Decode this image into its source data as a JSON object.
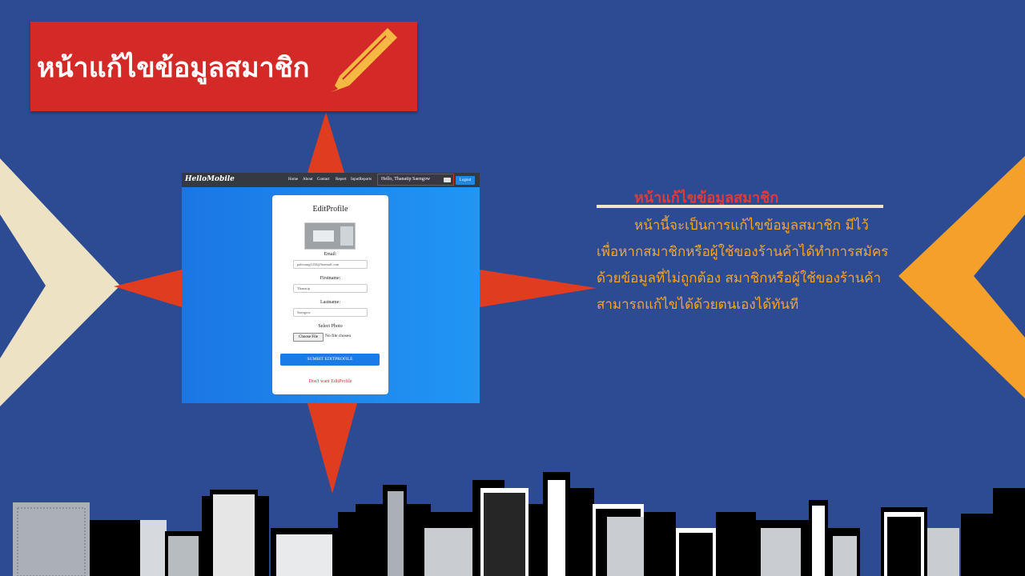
{
  "title": {
    "text": "หน้าแก้ไขข้อมูลสมาชิก"
  },
  "screenshot": {
    "brand": "HelloMobile",
    "nav": [
      "Home",
      "About",
      "Contact",
      "Report",
      "InputReports"
    ],
    "hello": "Hello, Thanatip  Saengow",
    "logout": "Logout",
    "form": {
      "title": "EditProfile",
      "email_label": "Email:",
      "email_value": "paleoung1234@hotmail.com",
      "firstname_label": "Firstname:",
      "firstname_value": "Thanatip",
      "lastname_label": "Lastname:",
      "lastname_value": "Saengow",
      "photo_label": "Select Photo",
      "choose_file": "Choose File",
      "file_status": "No file chosen",
      "submit": "SUMBIT EDITPROFILE",
      "cancel_link": "Don't want EditProfile"
    }
  },
  "description": {
    "heading": "หน้าแก้ไขข้อมูลสมาชิก",
    "lines": [
      "หน้านี้จะเป็นการแก้ไขข้อมูลสมาชิก มีไว้",
      "เพื่อหากสมาชิกหรือผู้ใช้ของร้านค้าได้ทำการสมัคร",
      "ด้วยข้อมูลที่ไม่ถูกต้อง สมาชิกหรือผู้ใช้ของร้านค้า",
      "สามารถแก้ไขได้ด้วยตนเองได้ทันที"
    ]
  },
  "colors": {
    "background": "#2d4b93",
    "banner": "#d42a27",
    "arrow": "#e03c1f",
    "chevron_left": "#ede3c4",
    "chevron_right": "#f5a02a",
    "description_text": "#f7a428"
  }
}
